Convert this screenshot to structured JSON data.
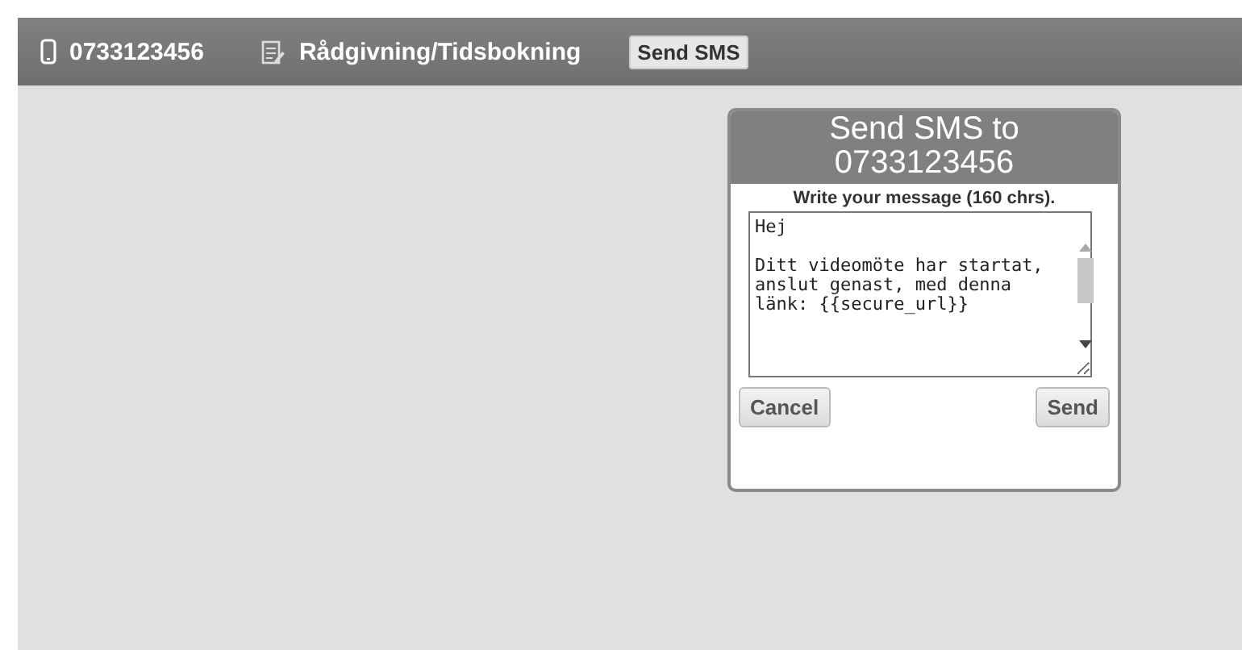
{
  "toolbar": {
    "phone": "0733123456",
    "service": "Rådgivning/Tidsbokning",
    "send_button": "Send SMS"
  },
  "dialog": {
    "title": "Send SMS to 0733123456",
    "prompt": "Write your message (160 chrs).",
    "message": "Hej\n\nDitt videomöte har startat, anslut genast, med denna länk: {{secure_url}}",
    "buttons": [
      "Cancel",
      "Send"
    ]
  }
}
